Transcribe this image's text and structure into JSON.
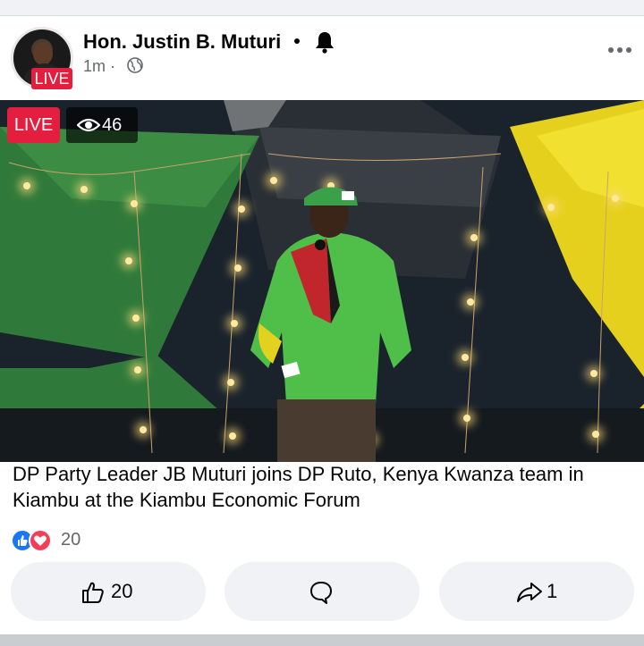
{
  "post": {
    "author": "Hon. Justin B. Muturi",
    "time": "1m",
    "avatar_live_label": "LIVE",
    "caption": "DP Party Leader JB Muturi joins DP Ruto, Kenya Kwanza team in Kiambu at the Kiambu Economic Forum"
  },
  "video": {
    "live_label": "LIVE",
    "viewer_count": "46"
  },
  "reactions": {
    "count": "20",
    "types": [
      "like",
      "love"
    ]
  },
  "actions": {
    "like_count": "20",
    "share_count": "1"
  },
  "colors": {
    "live_red": "#e41e3f",
    "like_blue": "#1877f2",
    "love_red": "#f33e58",
    "button_bg": "#f0f2f5"
  },
  "icons": {
    "bell": "bell-icon",
    "globe": "globe-icon",
    "more": "more-options-icon",
    "eye": "eye-icon",
    "like": "thumbs-up-icon",
    "comment": "comment-icon",
    "share": "share-icon"
  }
}
